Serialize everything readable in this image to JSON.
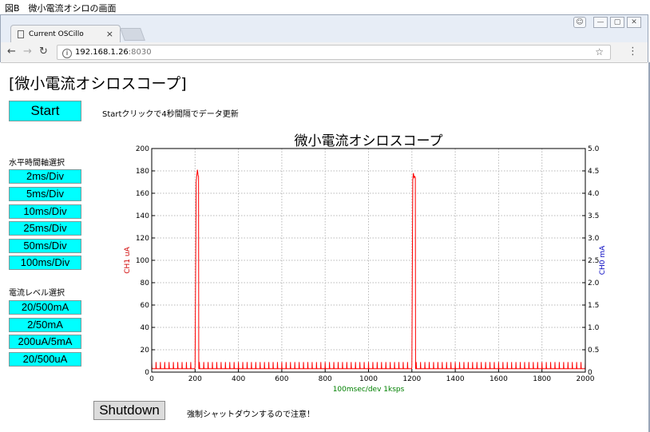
{
  "figure_caption": "図B　微小電流オシロの画面",
  "browser": {
    "tab_title": "Current OSCillo",
    "tab_close": "×",
    "url_host": "192.168.1.26",
    "url_port": ":8030",
    "window_buttons": [
      "—",
      "▢",
      "✕"
    ]
  },
  "page": {
    "heading": "[微小電流オシロスコープ]",
    "start_label": "Start",
    "start_note": "Startクリックで4秒間隔でデータ更新",
    "time_section_label": "水平時間軸選択",
    "time_buttons": [
      "2ms/Div",
      "5ms/Div",
      "10ms/Div",
      "25ms/Div",
      "50ms/Div",
      "100ms/Div"
    ],
    "level_section_label": "電流レベル選択",
    "level_buttons": [
      "20/500mA",
      "2/50mA",
      "200uA/5mA",
      "20/500uA"
    ],
    "shutdown_label": "Shutdown",
    "shutdown_note": "強制シャットダウンするので注意！"
  },
  "chart_data": {
    "type": "line",
    "title": "微小電流オシロスコープ",
    "xlabel": "100msec/dev  1ksps",
    "ylabel": "CH1  uA",
    "y2label": "CH0  mA",
    "xlim": [
      0,
      2000
    ],
    "ylim": [
      0,
      200
    ],
    "y2lim": [
      0,
      5.0
    ],
    "x_ticks": [
      "0",
      "200",
      "400",
      "600",
      "800",
      "1000",
      "1200",
      "1400",
      "1600",
      "1800",
      "2000"
    ],
    "y_ticks": [
      "0",
      "20",
      "40",
      "60",
      "80",
      "100",
      "120",
      "140",
      "160",
      "180",
      "200"
    ],
    "y2_ticks": [
      "0",
      "0.5",
      "1.0",
      "1.5",
      "2.0",
      "2.5",
      "3.0",
      "3.5",
      "4.0",
      "4.5",
      "5.0"
    ],
    "grid": true,
    "series": [
      {
        "name": "CH1",
        "color": "#ff0000",
        "baseline": 3,
        "ripple_peak": 9,
        "ripple_period": 20,
        "pulses": [
          {
            "x_start": 200,
            "x_end": 216,
            "values": [
              [
                200,
                5
              ],
              [
                205,
                170
              ],
              [
                208,
                176
              ],
              [
                211,
                181
              ],
              [
                214,
                176
              ],
              [
                216,
                175
              ]
            ]
          },
          {
            "x_start": 1200,
            "x_end": 1216,
            "values": [
              [
                1200,
                5
              ],
              [
                1204,
                172
              ],
              [
                1207,
                178
              ],
              [
                1210,
                174
              ],
              [
                1213,
                175
              ],
              [
                1216,
                174
              ]
            ]
          }
        ]
      }
    ],
    "colors": {
      "ch1_axis": "#d00000",
      "ch0_axis": "#0000c0",
      "xlabel": "#008000",
      "line": "#ff0000"
    }
  }
}
